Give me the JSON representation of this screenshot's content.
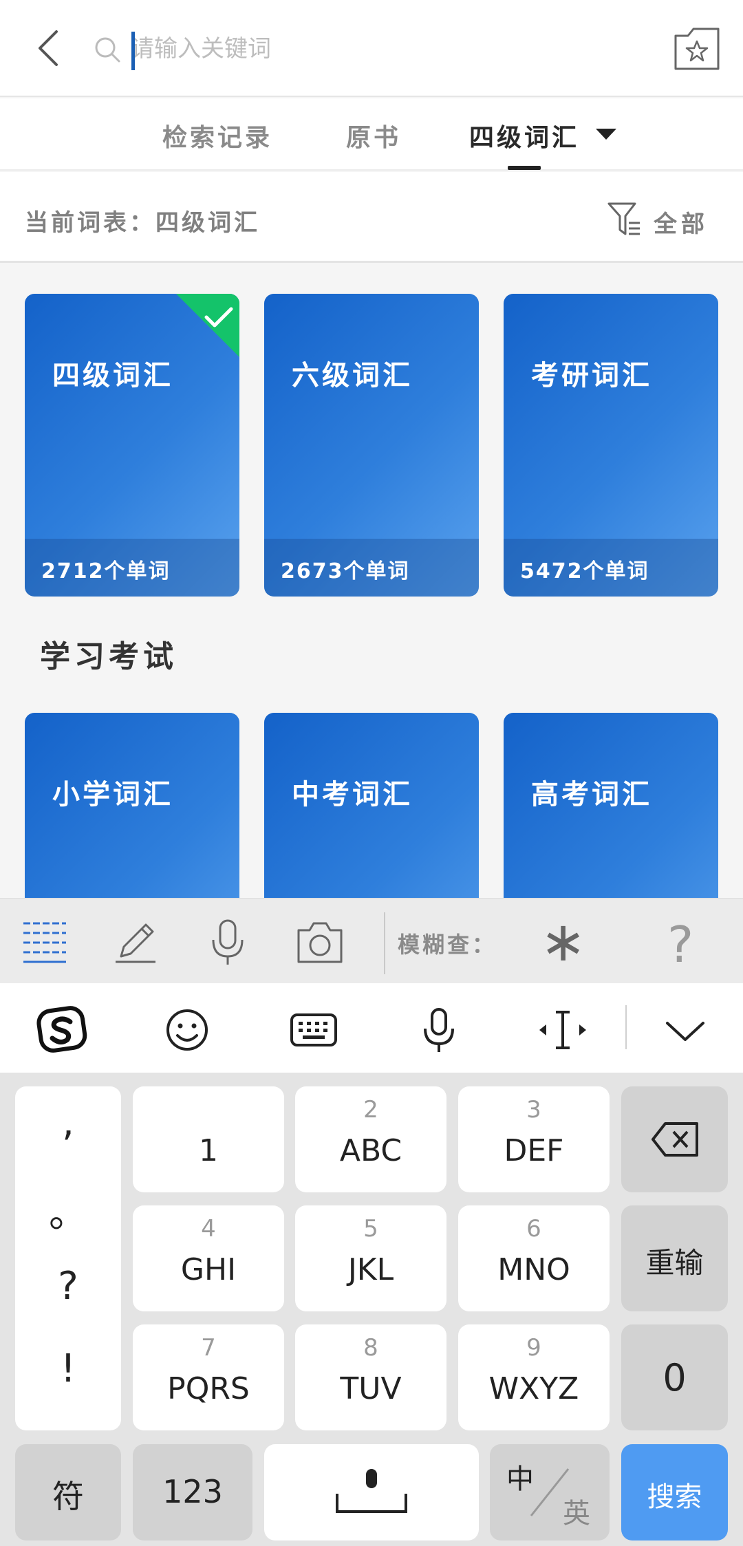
{
  "search": {
    "placeholder": "请输入关键词",
    "value": ""
  },
  "tabs": [
    {
      "label": "检索记录"
    },
    {
      "label": "原书"
    },
    {
      "label": "四级词汇"
    }
  ],
  "current": {
    "label": "当前词表：四级词汇",
    "filter_label": "全部"
  },
  "word_lists": [
    {
      "title": "四级词汇",
      "count": "2712个单词",
      "selected": true
    },
    {
      "title": "六级词汇",
      "count": "2673个单词"
    },
    {
      "title": "考研词汇",
      "count": "5472个单词"
    }
  ],
  "section": {
    "title": "学习考试"
  },
  "exam_lists": [
    {
      "title": "小学词汇"
    },
    {
      "title": "中考词汇"
    },
    {
      "title": "高考词汇"
    }
  ],
  "toolbar": {
    "fuzzy_label": "模糊查：",
    "wildcard_star": "∗",
    "wildcard_q": "?"
  },
  "keyboard": {
    "punct": [
      ",",
      "。",
      "?",
      "!"
    ],
    "keys": [
      {
        "num": "",
        "main": "1"
      },
      {
        "num": "2",
        "main": "ABC"
      },
      {
        "num": "3",
        "main": "DEF"
      },
      {
        "num": "4",
        "main": "GHI"
      },
      {
        "num": "5",
        "main": "JKL"
      },
      {
        "num": "6",
        "main": "MNO"
      },
      {
        "num": "7",
        "main": "PQRS"
      },
      {
        "num": "8",
        "main": "TUV"
      },
      {
        "num": "9",
        "main": "WXYZ"
      }
    ],
    "reset": "重输",
    "zero": "0",
    "symbols": "符",
    "num_mode": "123",
    "lang_cn": "中",
    "lang_en": "英",
    "search": "搜索"
  },
  "colors": {
    "card_blue": "#2f7fdc",
    "check_green": "#14c36a",
    "search_key": "#4f9bf2"
  }
}
